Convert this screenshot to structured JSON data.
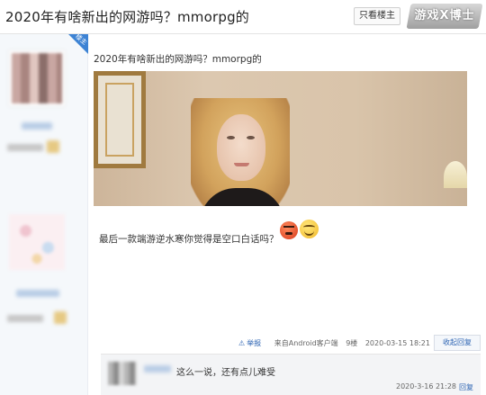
{
  "thread": {
    "title": "2020年有啥新出的网游吗？mmorpg的",
    "only_op_label": "只看楼主",
    "watermark": "游戏X博士"
  },
  "author": {
    "badge": "楼主"
  },
  "post": {
    "heading": "2020年有啥新出的网游吗？mmorpg的",
    "body": "最后一款端游逆水寒你觉得是空口白话吗？",
    "emojis": [
      "angry-emoji",
      "smile-emoji"
    ],
    "meta": {
      "report_label": "举报",
      "source": "来自Android客户端",
      "floor": "9楼",
      "datetime": "2020-03-15 18:21"
    },
    "collapse_label": "收起回复"
  },
  "reply": {
    "text": "这么一说，还有点儿难受",
    "datetime": "2020-3-16 21:28",
    "reply_label": "回复"
  },
  "colors": {
    "link": "#2d64b3",
    "badge": "#3d83d4",
    "sidebar_bg": "#f5f8fb"
  }
}
